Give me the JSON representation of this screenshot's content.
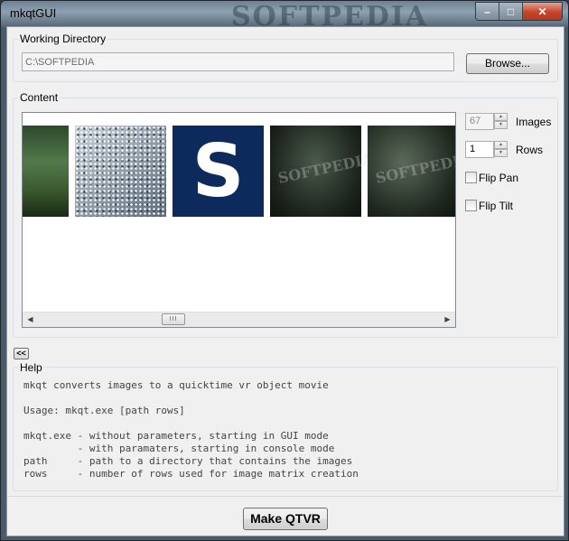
{
  "window": {
    "title": "mkqtGUI",
    "watermark": "SOFTPEDIA",
    "caption_buttons": {
      "minimize": "–",
      "maximize": "□",
      "close": "✕"
    }
  },
  "working_directory": {
    "label": "Working Directory",
    "path": "C:\\SOFTPEDIA",
    "browse_label": "Browse..."
  },
  "content": {
    "label": "Content",
    "thumbnails": [
      {
        "name": "forest-image",
        "watermark": ""
      },
      {
        "name": "city-aerial-image",
        "watermark": ""
      },
      {
        "name": "softpedia-logo-image",
        "glyph": "S"
      },
      {
        "name": "dark-forest-image",
        "watermark": "SOFTPEDIA"
      },
      {
        "name": "dark-forest-image-2",
        "watermark": "SOFTPEDIA"
      }
    ],
    "images_value": "67",
    "images_label": "Images",
    "rows_value": "1",
    "rows_label": "Rows",
    "flip_pan_label": "Flip Pan",
    "flip_tilt_label": "Flip Tilt",
    "flip_pan_checked": false,
    "flip_tilt_checked": false,
    "scroll_left": "◀",
    "scroll_right": "▶",
    "scroll_grip": "III"
  },
  "collapse_button": "<<",
  "help": {
    "label": "Help",
    "text": "mkqt converts images to a quicktime vr object movie\n\nUsage: mkqt.exe [path rows]\n\nmkqt.exe - without parameters, starting in GUI mode\n         - with paramaters, starting in console mode\npath     - path to a directory that contains the images\nrows     - number of rows used for image matrix creation"
  },
  "make_button_label": "Make QTVR"
}
